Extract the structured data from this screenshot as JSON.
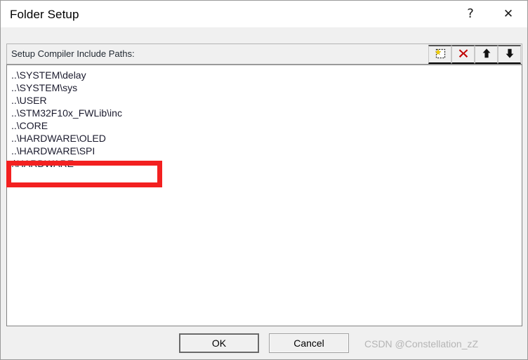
{
  "window": {
    "title": "Folder Setup",
    "help_glyph": "?",
    "close_glyph": "✕"
  },
  "header": {
    "label": "Setup Compiler Include Paths:",
    "toolbar": [
      {
        "name": "new-path-button",
        "icon": "new-item-icon",
        "title": "New (Insert)"
      },
      {
        "name": "delete-path-button",
        "icon": "delete-x-icon",
        "title": "Delete"
      },
      {
        "name": "move-up-button",
        "icon": "arrow-up-icon",
        "title": "Move Up"
      },
      {
        "name": "move-down-button",
        "icon": "arrow-down-icon",
        "title": "Move Down"
      }
    ]
  },
  "list": {
    "items": [
      "..\\SYSTEM\\delay",
      "..\\SYSTEM\\sys",
      "..\\USER",
      "..\\STM32F10x_FWLib\\inc",
      "..\\CORE",
      "..\\HARDWARE\\OLED",
      "..\\HARDWARE\\SPI",
      ".\\HARDWARE"
    ]
  },
  "annotation": {
    "color": "#f32020",
    "shape": "rectangle"
  },
  "footer": {
    "ok_label": "OK",
    "cancel_label": "Cancel",
    "watermark": "CSDN @Constellation_zZ"
  }
}
